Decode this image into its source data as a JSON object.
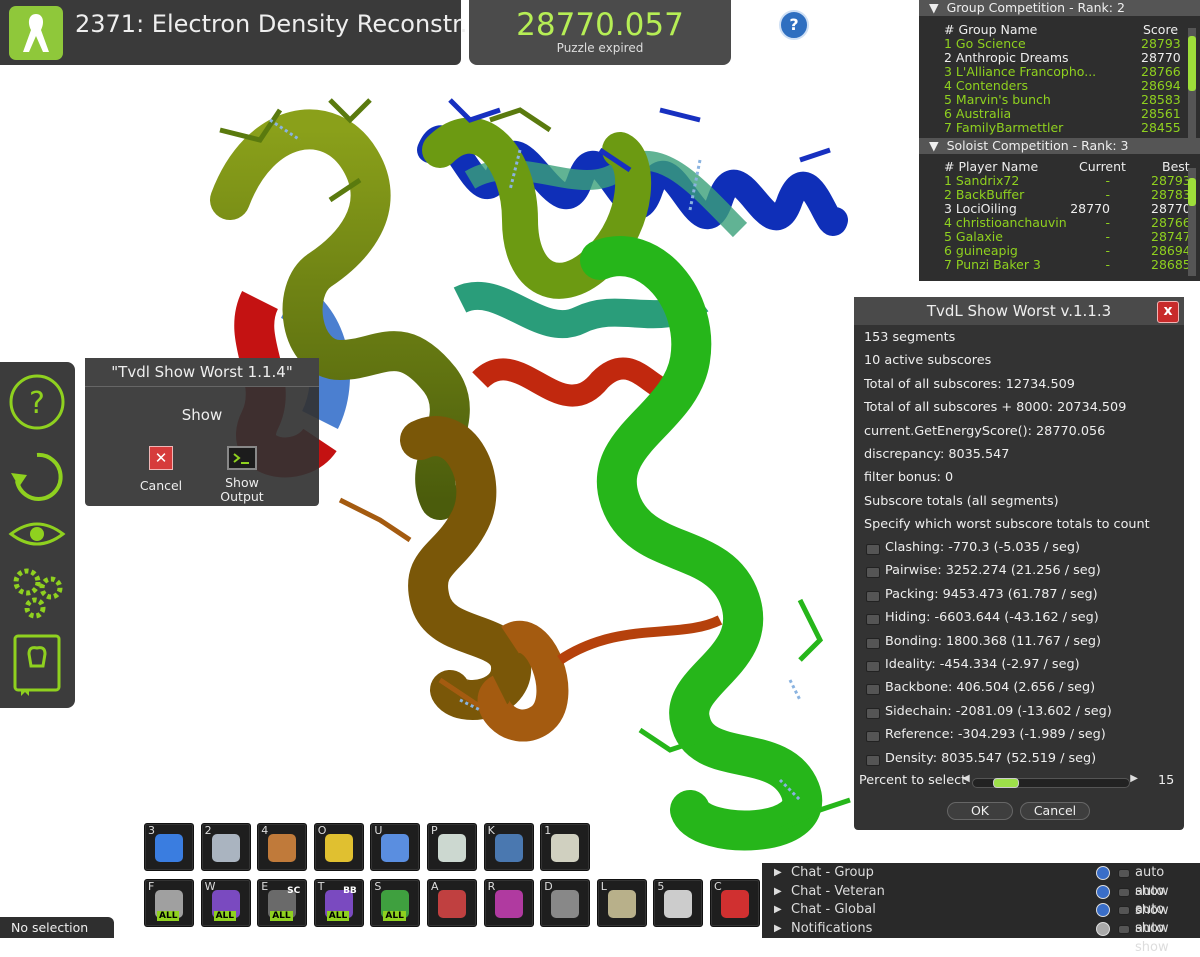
{
  "title": "2371: Electron Density Reconstr...",
  "score": "28770.057",
  "score_status": "Puzzle expired",
  "group_comp": {
    "header": "Group Competition - Rank: 2",
    "col_name": "# Group Name",
    "col_score": "Score",
    "rows": [
      {
        "name": "1 Go Science",
        "score": "28793"
      },
      {
        "name": "2 Anthropic Dreams",
        "score": "28770"
      },
      {
        "name": "3 L'Alliance Francopho...",
        "score": "28766"
      },
      {
        "name": "4 Contenders",
        "score": "28694"
      },
      {
        "name": "5 Marvin's bunch",
        "score": "28583"
      },
      {
        "name": "6 Australia",
        "score": "28561"
      },
      {
        "name": "7 FamilyBarmettler",
        "score": "28455"
      }
    ]
  },
  "solo_comp": {
    "header": "Soloist Competition - Rank: 3",
    "col_name": "# Player Name",
    "col_current": "Current",
    "col_best": "Best",
    "rows": [
      {
        "name": "1 Sandrix72",
        "current": "-",
        "best": "28793"
      },
      {
        "name": "2 BackBuffer",
        "current": "-",
        "best": "28783"
      },
      {
        "name": "3 LociOiling",
        "current": "28770",
        "best": "28770"
      },
      {
        "name": "4 christioanchauvin",
        "current": "-",
        "best": "28766"
      },
      {
        "name": "5 Galaxie",
        "current": "-",
        "best": "28747"
      },
      {
        "name": "6 guineapig",
        "current": "-",
        "best": "28694"
      },
      {
        "name": "7 Punzi Baker 3",
        "current": "-",
        "best": "28685"
      }
    ]
  },
  "small_dialog": {
    "title": "\"Tvdl Show Worst 1.1.4\"",
    "text": "Show",
    "cancel": "Cancel",
    "show_output_1": "Show",
    "show_output_2": "Output"
  },
  "big_dialog": {
    "title": "TvdL Show Worst v.1.1.3",
    "close": "x",
    "lines": [
      "153 segments",
      "10 active subscores",
      "Total of all subscores: 12734.509",
      "Total of all subscores + 8000: 20734.509",
      "current.GetEnergyScore(): 28770.056",
      "discrepancy: 8035.547",
      "filter bonus: 0",
      "Subscore totals (all segments)",
      "Specify which worst subscore totals to count"
    ],
    "subscores": [
      "Clashing:  -770.3 (-5.035 / seg)",
      "Pairwise:  3252.274 (21.256 / seg)",
      "Packing:  9453.473 (61.787 / seg)",
      "Hiding:  -6603.644 (-43.162 / seg)",
      "Bonding:  1800.368 (11.767 / seg)",
      "Ideality:  -454.334 (-2.97 / seg)",
      "Backbone:  406.504 (2.656 / seg)",
      "Sidechain:  -2081.09 (-13.602 / seg)",
      "Reference:  -304.293 (-1.989 / seg)",
      "Density:  8035.547 (52.519 / seg)"
    ],
    "percent_label": "Percent to select",
    "percent_value": "15",
    "percent_fraction": 0.15,
    "ok": "OK",
    "cancel": "Cancel"
  },
  "toolbar_row1": [
    {
      "key": "3",
      "icon": "move-icon"
    },
    {
      "key": "2",
      "icon": "tools-icon"
    },
    {
      "key": "4",
      "icon": "mutate-icon"
    },
    {
      "key": "O",
      "icon": "helmet-icon"
    },
    {
      "key": "U",
      "icon": "crop-icon"
    },
    {
      "key": "P",
      "icon": "map-icon"
    },
    {
      "key": "K",
      "icon": "globe-icon"
    },
    {
      "key": "1",
      "icon": "notepad-icon"
    }
  ],
  "toolbar_row2": [
    {
      "key": "F",
      "icon": "freeze-all-icon",
      "badge": "ALL"
    },
    {
      "key": "W",
      "icon": "wiggle-all-icon",
      "badge": "ALL"
    },
    {
      "key": "E",
      "icon": "shake-sc-icon",
      "badge": "ALL",
      "sub": "SC"
    },
    {
      "key": "T",
      "icon": "wiggle-bb-icon",
      "badge": "ALL",
      "sub": "BB"
    },
    {
      "key": "S",
      "icon": "shake-all-icon",
      "badge": "ALL"
    },
    {
      "key": "A",
      "icon": "rebuild-icon"
    },
    {
      "key": "R",
      "icon": "remove-band-icon"
    },
    {
      "key": "D",
      "icon": "microphone-icon"
    },
    {
      "key": "L",
      "icon": "density-icon"
    },
    {
      "key": "5",
      "icon": "lighthouse-icon"
    },
    {
      "key": "C",
      "icon": "scissors-icon"
    }
  ],
  "chat": [
    {
      "label": "Chat - Group",
      "auto": "auto show"
    },
    {
      "label": "Chat - Veteran",
      "auto": "auto show"
    },
    {
      "label": "Chat - Global",
      "auto": "auto show"
    },
    {
      "label": "Notifications",
      "auto": "auto show"
    }
  ],
  "status": "No selection",
  "colors": {
    "accent": "#8fd11f",
    "panel": "#3a3a3a"
  }
}
